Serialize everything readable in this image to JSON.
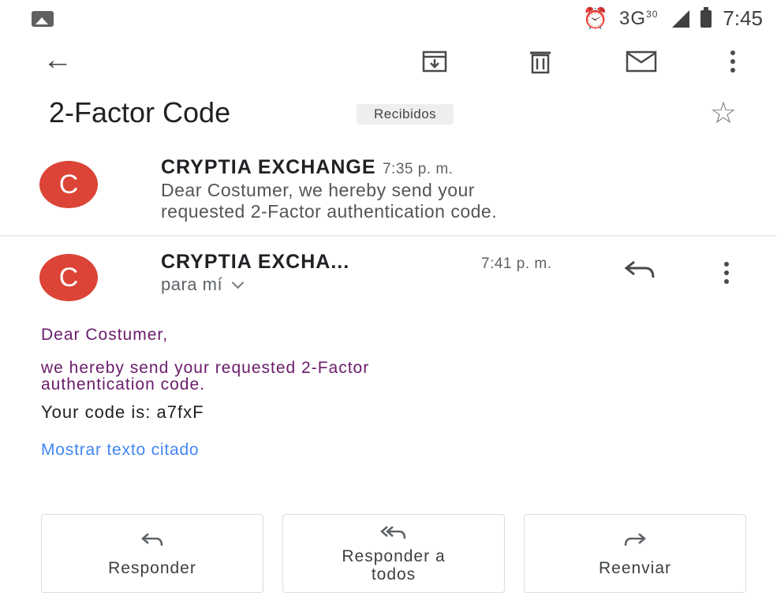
{
  "status_bar": {
    "network": "3G",
    "network_sup": "30",
    "time": "7:45"
  },
  "toolbar": {
    "back_icon": "arrow-back-icon",
    "archive_icon": "archive-icon",
    "delete_icon": "trash-icon",
    "mark_unread_icon": "mail-icon",
    "more_icon": "more-vert-icon"
  },
  "thread": {
    "subject": "2-Factor Code",
    "label": "Recibidos"
  },
  "messages": [
    {
      "avatar_letter": "C",
      "sender": "CRYPTIA EXCHANGE",
      "time": "7:35 p. m.",
      "snippet_line1": "Dear Costumer, we hereby send your",
      "snippet_line2": "requested 2-Factor authentication code."
    },
    {
      "avatar_letter": "C",
      "sender": "CRYPTIA EXCHA...",
      "time": "7:41 p. m.",
      "recipient": "para mí",
      "greeting": "Dear Costumer,",
      "body_line1": "we hereby send your requested 2-Factor",
      "body_line2": "authentication code.",
      "code_line": "Your code is: a7fxF",
      "show_quoted": "Mostrar texto citado"
    }
  ],
  "actions": {
    "reply": "Responder",
    "reply_all_line1": "Responder a",
    "reply_all_line2": "todos",
    "forward": "Reenviar"
  },
  "colors": {
    "avatar": "#db4437",
    "body_text": "#6a1b6a",
    "link": "#4285f4"
  }
}
